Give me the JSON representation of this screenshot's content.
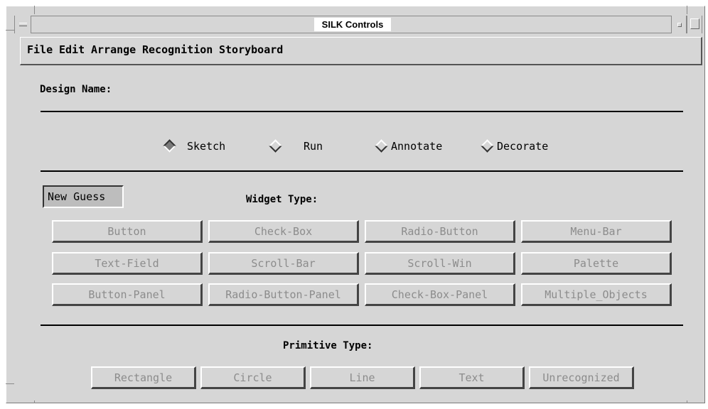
{
  "window": {
    "title": "SILK Controls"
  },
  "menu": [
    "File",
    "Edit",
    "Arrange",
    "Recognition",
    "Storyboard"
  ],
  "design": {
    "label": "Design Name:",
    "value": ""
  },
  "modes": {
    "selected": "Sketch",
    "options": [
      "Sketch",
      "Run",
      "Annotate",
      "Decorate"
    ]
  },
  "new_guess_label": "New Guess",
  "widget_type": {
    "label": "Widget Type:",
    "buttons": [
      [
        "Button",
        "Check-Box",
        "Radio-Button",
        "Menu-Bar"
      ],
      [
        "Text-Field",
        "Scroll-Bar",
        "Scroll-Win",
        "Palette"
      ],
      [
        "Button-Panel",
        "Radio-Button-Panel",
        "Check-Box-Panel",
        "Multiple_Objects"
      ]
    ]
  },
  "primitive_type": {
    "label": "Primitive Type:",
    "buttons": [
      "Rectangle",
      "Circle",
      "Line",
      "Text",
      "Unrecognized"
    ]
  },
  "colors": {
    "background": "#d6d6d6",
    "disabled_text": "#8c8c8c",
    "separator": "#000000"
  },
  "icons": {
    "minimize": "minimize-icon",
    "maximize": "maximize-icon",
    "restore": "restore-icon"
  }
}
